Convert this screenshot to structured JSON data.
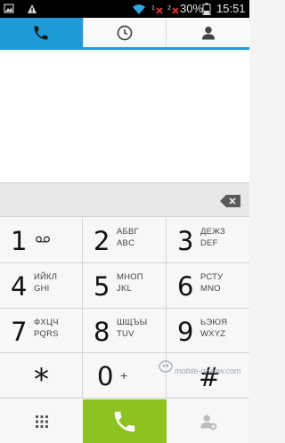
{
  "status_bar": {
    "battery_percent": "30%",
    "time": "15:51",
    "icons": [
      "image-icon",
      "warning-icon",
      "wifi-icon",
      "signal-icon",
      "signal-icon",
      "battery-icon"
    ]
  },
  "tabs": [
    {
      "name": "phone-icon",
      "active": true
    },
    {
      "name": "clock-icon",
      "active": false
    },
    {
      "name": "contact-icon",
      "active": false
    }
  ],
  "dialer": {
    "number": ""
  },
  "keys": [
    {
      "digit": "1",
      "top": "",
      "bottom": "",
      "voicemail": true
    },
    {
      "digit": "2",
      "top": "АБВГ",
      "bottom": "ABC"
    },
    {
      "digit": "3",
      "top": "ДЕЖЗ",
      "bottom": "DEF"
    },
    {
      "digit": "4",
      "top": "ИЙКЛ",
      "bottom": "GHI"
    },
    {
      "digit": "5",
      "top": "МНОП",
      "bottom": "JKL"
    },
    {
      "digit": "6",
      "top": "РСТУ",
      "bottom": "MNO"
    },
    {
      "digit": "7",
      "top": "ФХЦЧ",
      "bottom": "PQRS"
    },
    {
      "digit": "8",
      "top": "ШЩЪЫ",
      "bottom": "TUV"
    },
    {
      "digit": "9",
      "top": "ЬЭЮЯ",
      "bottom": "WXYZ"
    },
    {
      "digit": "*",
      "top": "",
      "bottom": ""
    },
    {
      "digit": "0",
      "plus": "+"
    },
    {
      "digit": "#",
      "top": "",
      "bottom": ""
    }
  ],
  "watermark": "mobile-review.com",
  "colors": {
    "accent": "#1e9bd7",
    "call_green": "#8dc21f",
    "status_red": "#e53935"
  }
}
